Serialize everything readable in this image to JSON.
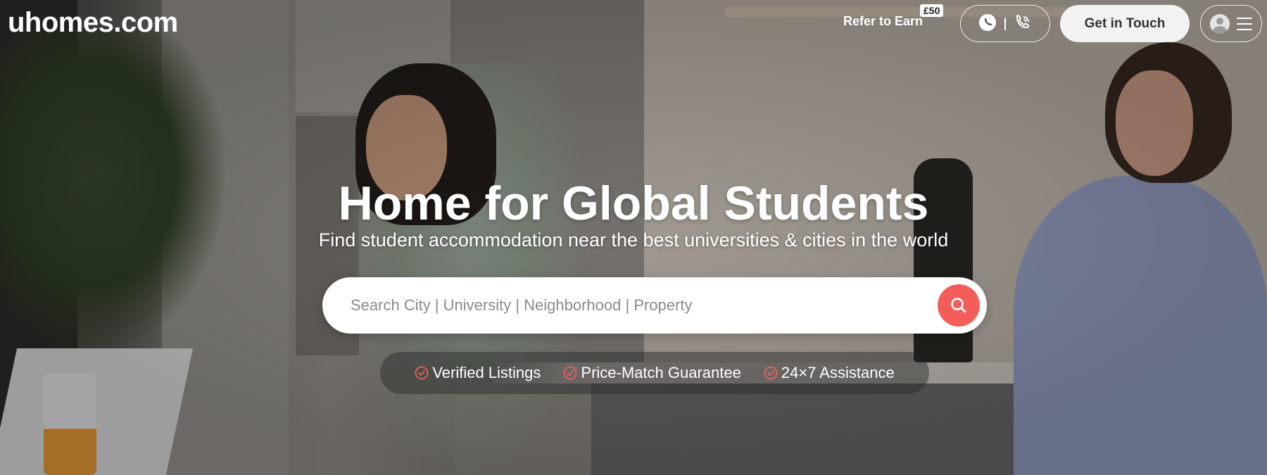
{
  "header": {
    "logo": "uhomes.com",
    "refer_label": "Refer to Earn",
    "refer_badge": "£50",
    "contact_icons": [
      "whatsapp-icon",
      "phone-icon"
    ],
    "get_in_touch_label": "Get in Touch",
    "account_icons": [
      "avatar-icon",
      "menu-icon"
    ]
  },
  "hero": {
    "title": "Home for Global Students",
    "subtitle": "Find student accommodation near the best universities & cities in the world"
  },
  "search": {
    "placeholder": "Search City | University | Neighborhood | Property",
    "button_icon": "search-icon"
  },
  "features": [
    {
      "icon": "check-circle-icon",
      "label": "Verified Listings"
    },
    {
      "icon": "check-circle-icon",
      "label": "Price-Match Guarantee"
    },
    {
      "icon": "check-circle-icon",
      "label": "24×7 Assistance"
    }
  ],
  "colors": {
    "accent": "#f45d5a",
    "button_bg": "#f2f2f2",
    "text": "#ffffff"
  }
}
